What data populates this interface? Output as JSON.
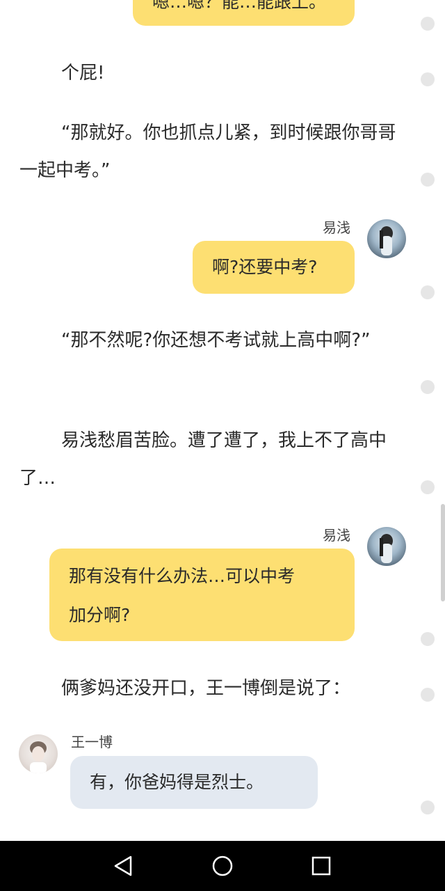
{
  "chat": {
    "top_bubble": "嗯…嗯？能…能跟上。",
    "narration1": "个屁!",
    "narration2": "“那就好。你也抓点儿紧，到时候跟你哥哥一起中考。”",
    "msg1": {
      "sender": "易浅",
      "text": "啊?还要中考?"
    },
    "narration3": "“那不然呢?你还想不考试就上高中啊?”",
    "narration4": "易浅愁眉苦脸。遭了遭了，我上不了高中了…",
    "msg2": {
      "sender": "易浅",
      "text_line1": "那有没有什么办法…可以中考",
      "text_line2": "加分啊?"
    },
    "narration5": "俩爹妈还没开口，王一博倒是说了：",
    "msg3": {
      "sender": "王一博",
      "text": "有，你爸妈得是烈士。"
    }
  },
  "colors": {
    "self_bubble": "#fddf72",
    "other_bubble": "#e3e9f1",
    "navbar": "#000000"
  },
  "icons": {
    "nav_back": "triangle-back-icon",
    "nav_home": "circle-home-icon",
    "nav_recent": "square-recent-icon"
  }
}
